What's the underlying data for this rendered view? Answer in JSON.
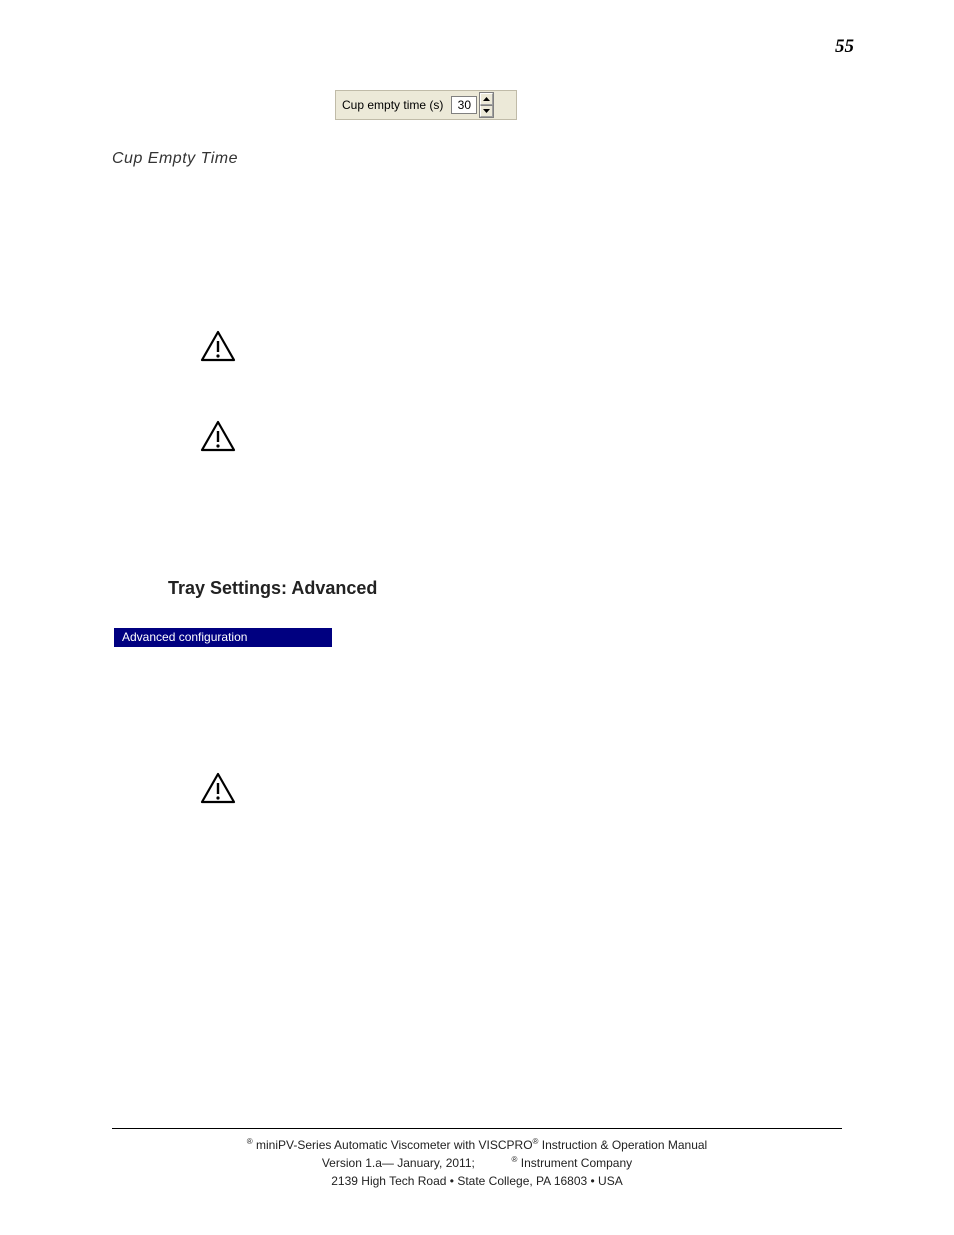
{
  "page": {
    "number": "55"
  },
  "spin": {
    "label": "Cup empty time (s)",
    "value": "30"
  },
  "caption": "Cup Empty Time",
  "section_heading": "Tray Settings: Advanced",
  "adv_bar": "Advanced configuration",
  "footer": {
    "line1_pre": " miniPV-Series Automatic Viscometer with VISCPRO",
    "line1_post": " Instruction & Operation Manual",
    "line2_pre": "Version 1.a— January, 2011;",
    "line2_post": " Instrument Company",
    "line3": "2139 High Tech Road • State College, PA  16803 • USA"
  }
}
